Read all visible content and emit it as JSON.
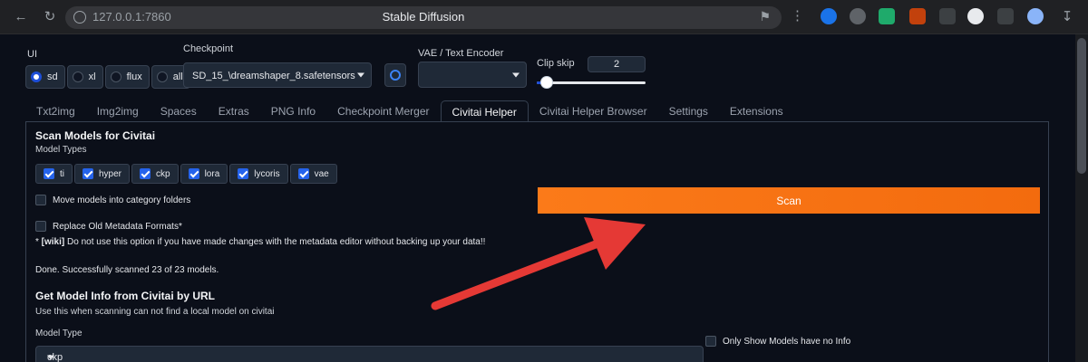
{
  "browser": {
    "url": "127.0.0.1:7860",
    "title": "Stable Diffusion"
  },
  "settings": {
    "ui_label": "UI",
    "ui_options": [
      {
        "label": "sd",
        "selected": true
      },
      {
        "label": "xl",
        "selected": false
      },
      {
        "label": "flux",
        "selected": false
      },
      {
        "label": "all",
        "selected": false
      }
    ],
    "checkpoint_label": "Checkpoint",
    "checkpoint_value": "SD_15_\\dreamshaper_8.safetensors",
    "vae_label": "VAE / Text Encoder",
    "vae_value": "",
    "clip_skip_label": "Clip skip",
    "clip_skip_value": "2"
  },
  "tabs": [
    {
      "label": "Txt2img",
      "active": false
    },
    {
      "label": "Img2img",
      "active": false
    },
    {
      "label": "Spaces",
      "active": false
    },
    {
      "label": "Extras",
      "active": false
    },
    {
      "label": "PNG Info",
      "active": false
    },
    {
      "label": "Checkpoint Merger",
      "active": false
    },
    {
      "label": "Civitai Helper",
      "active": true
    },
    {
      "label": "Civitai Helper Browser",
      "active": false
    },
    {
      "label": "Settings",
      "active": false
    },
    {
      "label": "Extensions",
      "active": false
    }
  ],
  "scan": {
    "heading": "Scan Models for Civitai",
    "model_types_label": "Model Types",
    "model_types": [
      {
        "label": "ti",
        "checked": true
      },
      {
        "label": "hyper",
        "checked": true
      },
      {
        "label": "ckp",
        "checked": true
      },
      {
        "label": "lora",
        "checked": true
      },
      {
        "label": "lycoris",
        "checked": true
      },
      {
        "label": "vae",
        "checked": true
      }
    ],
    "move_models_label": "Move models into category folders",
    "replace_metadata_label": "Replace Old Metadata Formats*",
    "wiki_note_prefix": "* ",
    "wiki_note_link": "[wiki]",
    "wiki_note_text": " Do not use this option if you have made changes with the metadata editor without backing up your data!!",
    "scan_button": "Scan",
    "status": "Done. Successfully scanned 23 of 23 models."
  },
  "get_info": {
    "heading": "Get Model Info from Civitai by URL",
    "description": "Use this when scanning can not find a local model on civitai",
    "model_type_label": "Model Type",
    "model_type_value": "ckp",
    "only_show_label": "Only Show Models have no Info"
  },
  "colors": {
    "scan_button": "#f97316",
    "annotation_arrow": "#e53935",
    "accent": "#2563eb"
  }
}
